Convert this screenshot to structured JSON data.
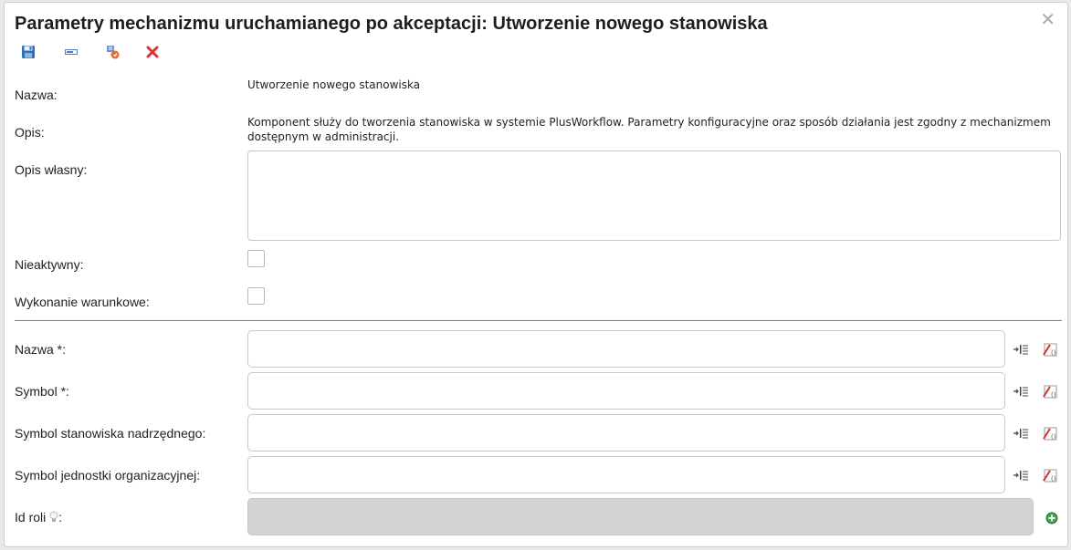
{
  "dialog": {
    "title": "Parametry mechanizmu uruchamianego po akceptacji: Utworzenie nowego stanowiska",
    "close_symbol": "✕"
  },
  "toolbar": {
    "buttons": [
      {
        "name": "save-icon"
      },
      {
        "name": "field-icon"
      },
      {
        "name": "run-test-icon"
      },
      {
        "name": "delete-icon"
      }
    ]
  },
  "form": {
    "nazwa_label": "Nazwa:",
    "nazwa_value": "Utworzenie nowego stanowiska",
    "opis_label": "Opis:",
    "opis_value": "Komponent służy do tworzenia stanowiska w systemie PlusWorkflow. Parametry konfiguracyjne oraz sposób działania jest zgodny z mechanizmem dostępnym w administracji.",
    "opis_wlasny_label": "Opis własny:",
    "nieaktywny_label": "Nieaktywny:",
    "wykonanie_label": "Wykonanie warunkowe:",
    "params": [
      {
        "label": "Nazwa *:"
      },
      {
        "label": "Symbol *:"
      },
      {
        "label": "Symbol stanowiska nadrzędnego:"
      },
      {
        "label": "Symbol jednostki organizacyjnej:"
      }
    ],
    "id_roli_label": "Id roli",
    "id_roli_suffix": ":"
  },
  "colors": {
    "divider": "#6f8399",
    "disabled_input": "#d3d3d3",
    "delete_red": "#e03030",
    "add_green": "#3aa34a"
  }
}
